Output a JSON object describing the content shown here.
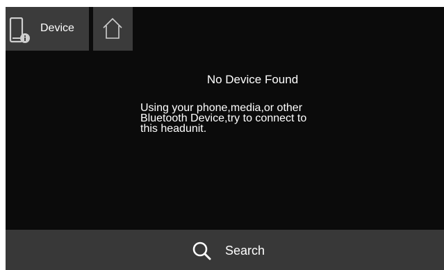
{
  "header": {
    "device_tab_label": "Device",
    "device_tab_icon": "phone-info-icon",
    "home_tab_icon": "home-icon"
  },
  "main": {
    "title": "No Device Found",
    "message": "Using your phone,media,or other\nBluetooth Device,try to connect to\nthis headunit."
  },
  "footer": {
    "search_label": "Search",
    "search_icon": "search-icon"
  },
  "colors": {
    "screen_background": "#0b0b0b",
    "tab_background": "#3b3b3b",
    "bar_background": "#383838",
    "text": "#ffffff"
  }
}
